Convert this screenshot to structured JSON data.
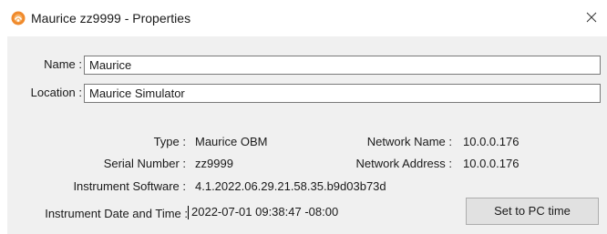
{
  "window": {
    "title": "Maurice zz9999 - Properties",
    "icon": "maurice-app-icon",
    "close_glyph": "✕"
  },
  "form": {
    "name_label": "Name :",
    "name_value": "Maurice",
    "location_label": "Location :",
    "location_value": "Maurice Simulator"
  },
  "info": {
    "type_label": "Type :",
    "type_value": "Maurice OBM",
    "serial_label": "Serial Number :",
    "serial_value": "zz9999",
    "software_label": "Instrument Software :",
    "software_value": "4.1.2022.06.29.21.58.35.b9d03b73d",
    "network_name_label": "Network Name :",
    "network_name_value": "10.0.0.176",
    "network_address_label": "Network Address :",
    "network_address_value": "10.0.0.176",
    "datetime_label": "Instrument Date and Time :",
    "datetime_value": "2022-07-01 09:38:47 -08:00"
  },
  "buttons": {
    "set_pc_time": "Set to PC time"
  },
  "colors": {
    "panel_bg": "#f0f0f0",
    "icon_orange": "#f08a2c"
  }
}
